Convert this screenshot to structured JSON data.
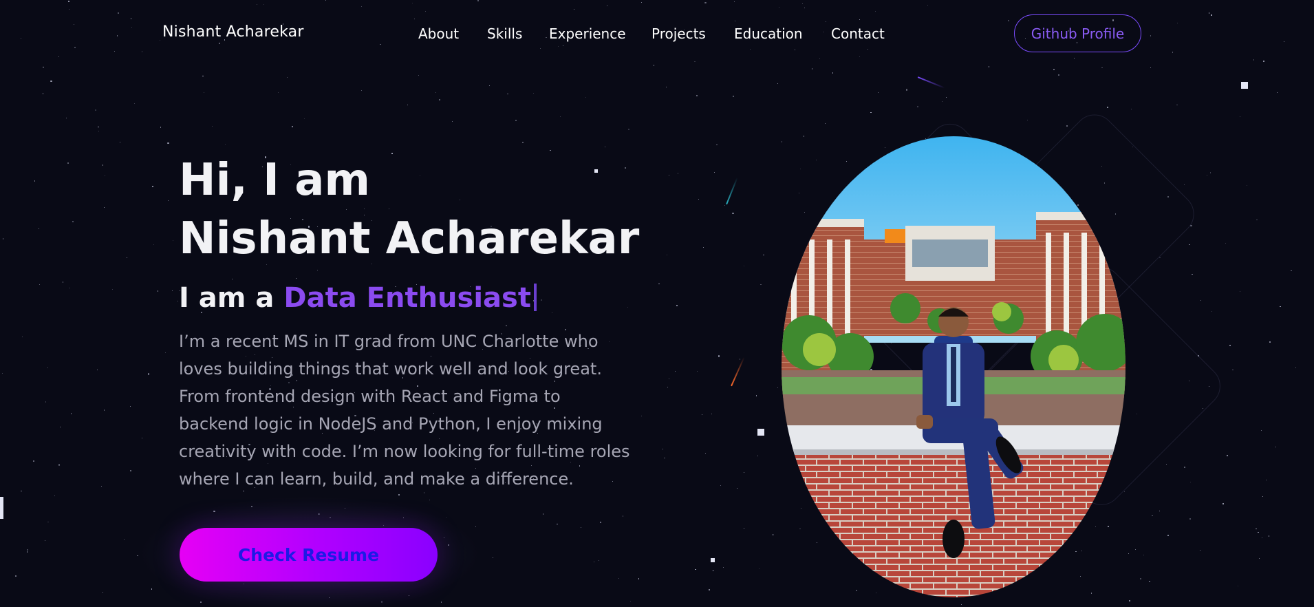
{
  "navbar": {
    "brand": "Nishant Acharekar",
    "links": [
      {
        "label": "About"
      },
      {
        "label": "Skills"
      },
      {
        "label": "Experience"
      },
      {
        "label": "Projects"
      },
      {
        "label": "Education"
      },
      {
        "label": "Contact"
      }
    ],
    "github_label": "Github Profile"
  },
  "hero": {
    "greeting": "Hi, I am",
    "name": "Nishant Acharekar",
    "role_prefix": "I am a",
    "role_highlight": "Data Enthusiast",
    "bio_lines": [
      "I’m a recent MS in IT grad from UNC Charlotte who",
      "loves building things that work well and look great.",
      "From frontend design with React and Figma to",
      "backend logic in NodeJS and Python, I enjoy mixing",
      "creativity with code. I’m now looking for full-time roles",
      "where I can learn, build, and make a difference."
    ],
    "resume_label": "Check Resume"
  },
  "colors": {
    "background": "#090a16",
    "accent": "#8b4bf0",
    "button_gradient_start": "#e600f5",
    "button_gradient_end": "#8a00ff",
    "button_text": "#1d1ae6"
  }
}
